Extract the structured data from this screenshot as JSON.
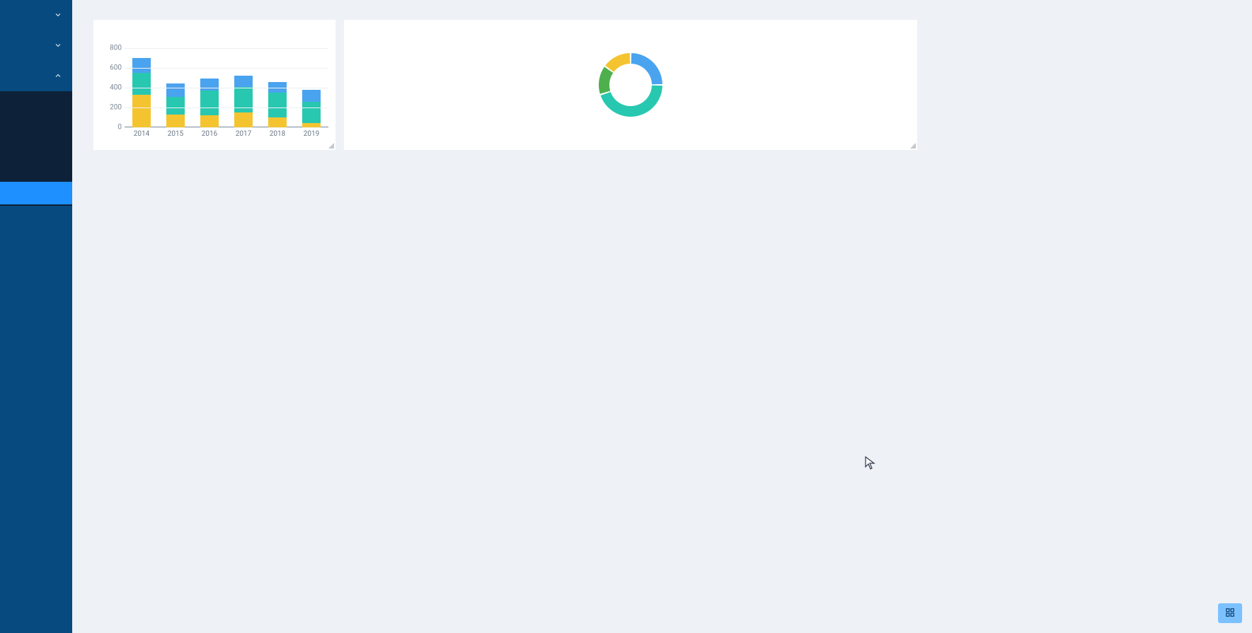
{
  "colors": {
    "yellow": "#f4c430",
    "teal": "#28c8b0",
    "blue": "#4aa3ee",
    "green": "#4db04d"
  },
  "chart_data": [
    {
      "type": "bar-stacked",
      "categories": [
        "2014",
        "2015",
        "2016",
        "2017",
        "2018",
        "2019"
      ],
      "series": [
        {
          "name": "yellow",
          "color": "#f4c430",
          "values": [
            330,
            130,
            120,
            150,
            100,
            40
          ]
        },
        {
          "name": "teal",
          "color": "#28c8b0",
          "values": [
            220,
            180,
            250,
            260,
            250,
            220
          ]
        },
        {
          "name": "blue",
          "color": "#4aa3ee",
          "values": [
            150,
            130,
            120,
            110,
            110,
            120
          ]
        }
      ],
      "ylim": [
        0,
        800
      ],
      "y_ticks": [
        0,
        200,
        400,
        600,
        800
      ],
      "xlabel": "",
      "ylabel": "",
      "title": ""
    },
    {
      "type": "donut",
      "slices": [
        {
          "name": "blue",
          "color": "#4aa3ee",
          "value": 25
        },
        {
          "name": "teal",
          "color": "#28c8b0",
          "value": 45
        },
        {
          "name": "green",
          "color": "#4db04d",
          "value": 15
        },
        {
          "name": "yellow",
          "color": "#f4c430",
          "value": 15
        }
      ],
      "title": ""
    }
  ]
}
